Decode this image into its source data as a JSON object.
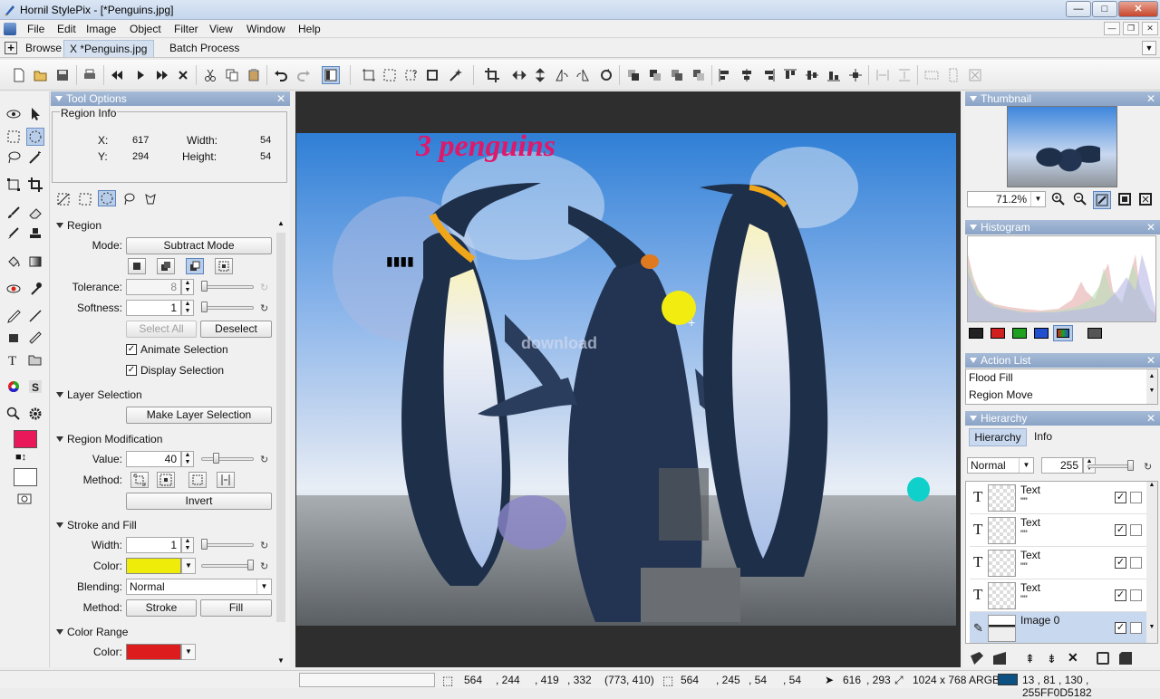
{
  "window": {
    "title": "Hornil StylePix - [*Penguins.jpg]",
    "minimize": "—",
    "maximize": "□",
    "close": "✕"
  },
  "menu": [
    "File",
    "Edit",
    "Image",
    "Object",
    "Filter",
    "View",
    "Window",
    "Help"
  ],
  "mdi": {
    "minimize": "—",
    "restore": "❐",
    "close": "✕"
  },
  "tabs": {
    "browse": "Browse",
    "doc": "*Penguins.jpg",
    "doc_close": "X",
    "batch": "Batch Process",
    "plus": "+",
    "chevron": "▼"
  },
  "tool_options": {
    "title": "Tool Options",
    "close": "✕",
    "region_info": {
      "label": "Region Info",
      "x_label": "X:",
      "x": "617",
      "y_label": "Y:",
      "y": "294",
      "w_label": "Width:",
      "w": "54",
      "h_label": "Height:",
      "h": "54"
    },
    "region": {
      "title": "Region",
      "mode_label": "Mode:",
      "mode_value": "Subtract Mode",
      "tolerance_label": "Tolerance:",
      "tolerance": "8",
      "softness_label": "Softness:",
      "softness": "1",
      "select_all": "Select All",
      "deselect": "Deselect",
      "animate": "Animate Selection",
      "display": "Display Selection"
    },
    "layer_selection": {
      "title": "Layer Selection",
      "button": "Make Layer Selection"
    },
    "region_mod": {
      "title": "Region Modification",
      "value_label": "Value:",
      "value": "40",
      "method_label": "Method:",
      "invert": "Invert"
    },
    "stroke_fill": {
      "title": "Stroke and Fill",
      "width_label": "Width:",
      "width": "1",
      "color_label": "Color:",
      "color": "#f0ec0a",
      "blending_label": "Blending:",
      "blending": "Normal",
      "method_label": "Method:",
      "stroke": "Stroke",
      "fill": "Fill"
    },
    "color_range": {
      "title": "Color Range",
      "color_label": "Color:",
      "color": "#dd1d1d"
    }
  },
  "canvas": {
    "image_title": "3 penguins",
    "watermark": "download"
  },
  "thumbnail": {
    "title": "Thumbnail",
    "close": "✕",
    "zoom": "71.2%"
  },
  "histogram": {
    "title": "Histogram",
    "close": "✕"
  },
  "action_list": {
    "title": "Action List",
    "close": "✕",
    "items": [
      "Flood Fill",
      "Region Move"
    ]
  },
  "hierarchy": {
    "title": "Hierarchy",
    "close": "✕",
    "tabs": [
      "Hierarchy",
      "Info"
    ],
    "blend": "Normal",
    "opacity": "255",
    "layers": [
      {
        "icon": "T",
        "name": "Text",
        "sub": "\"\""
      },
      {
        "icon": "T",
        "name": "Text",
        "sub": "\"\""
      },
      {
        "icon": "T",
        "name": "Text",
        "sub": "\"\""
      },
      {
        "icon": "T",
        "name": "Text",
        "sub": "\"\""
      },
      {
        "icon": "",
        "name": "Image 0",
        "sub": ""
      }
    ]
  },
  "status": {
    "sel_x": "564",
    "sel_y": ", 244",
    "sel_w": ", 419",
    "sel_h": ", 332",
    "sel_size": "(773, 410)",
    "reg_x": "564",
    "reg_y": ", 245",
    "reg_w": ", 54",
    "reg_h": ", 54",
    "cursor_x": "616",
    "cursor_y": ", 293",
    "image_size": "1024 x 768 ARGB",
    "pixel_value": "13    , 81   , 130 , 255FF0D5182"
  },
  "colors": {
    "accent": "#8aa3c6",
    "fg": "#e8185a",
    "bg": "#ffffff",
    "ellipse_yellow": "#f2ec10",
    "ellipse_cyan": "#10d0cc",
    "title_pink": "#e0186a"
  }
}
